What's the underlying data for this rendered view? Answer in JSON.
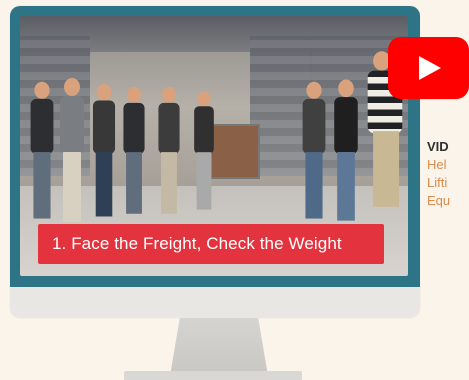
{
  "video": {
    "caption": "1. Face the Freight, Check the Weight"
  },
  "side_panel": {
    "title": "VID",
    "lines": [
      "Hel",
      "Lifti",
      "Equ"
    ]
  },
  "icons": {
    "play": "play-icon"
  },
  "colors": {
    "background": "#fbf4ea",
    "monitor_frame": "#2c7486",
    "caption_bg": "#e3333f",
    "youtube_red": "#ff0000",
    "side_text": "#d98b4a"
  }
}
